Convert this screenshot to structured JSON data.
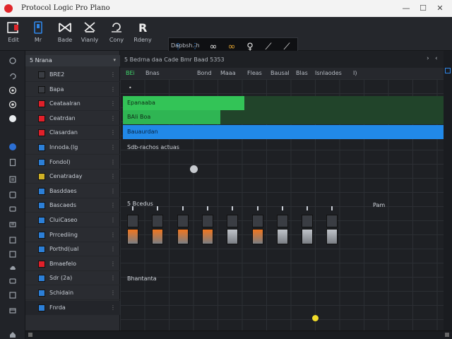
{
  "window": {
    "title": "Protocol Logic Pro Plano"
  },
  "toolbar": {
    "tools": [
      {
        "icon": "record-square-icon",
        "label": "Edit"
      },
      {
        "icon": "phone-icon",
        "label": "Mr"
      },
      {
        "icon": "bowtie-icon",
        "label": "Bade"
      },
      {
        "icon": "scissors-icon",
        "label": "Vianly"
      },
      {
        "icon": "undo-icon",
        "label": "Cony"
      },
      {
        "icon": "r-letter-icon",
        "label": "Rdeny"
      }
    ],
    "brushes_label": "Dapbsh..h",
    "brushes": [
      {
        "icon": "tuning-fork-icon",
        "glyph": "⫯",
        "color": "#2f86e8"
      },
      {
        "icon": "mixer-icon",
        "glyph": "⫶",
        "color": "#2f86e8"
      },
      {
        "icon": "infinity-icon",
        "glyph": "∞",
        "color": "#e6e6e6"
      },
      {
        "icon": "infinity-gold-icon",
        "glyph": "∞",
        "color": "#e5a531"
      },
      {
        "icon": "lens-icon",
        "glyph": "♀",
        "color": "#e6e6e6"
      },
      {
        "icon": "curve-icon",
        "glyph": "⟋",
        "color": "#e6e6e6"
      },
      {
        "icon": "arc-icon",
        "glyph": "⟋",
        "color": "#e6e6e6"
      }
    ]
  },
  "tracklist": {
    "header": "5 Nrana",
    "tracks": [
      {
        "name": "BRE2",
        "color": "#3a3d43"
      },
      {
        "name": "Bapa",
        "color": "#3a3d43"
      },
      {
        "name": "Ceataalran",
        "color": "#e0202a"
      },
      {
        "name": "Ceatrdan",
        "color": "#e0202a"
      },
      {
        "name": "Clasardan",
        "color": "#e0202a"
      },
      {
        "name": "Innoda.(lg",
        "color": "#2c7fd7"
      },
      {
        "name": "Fondol)",
        "color": "#2c7fd7"
      },
      {
        "name": "Cenatraday",
        "color": "#d0b126"
      },
      {
        "name": "Basddaes",
        "color": "#2c7fd7"
      },
      {
        "name": "Bascaeds",
        "color": "#2c7fd7"
      },
      {
        "name": "CluiCaseo",
        "color": "#2c7fd7"
      },
      {
        "name": "Prrcediing",
        "color": "#2c7fd7"
      },
      {
        "name": "Porthd(ual",
        "color": "#2c7fd7"
      },
      {
        "name": "Bmaefelo",
        "color": "#e0202a"
      },
      {
        "name": "Sdr (2a)",
        "color": "#2c7fd7"
      },
      {
        "name": "Schidain",
        "color": "#2c7fd7"
      },
      {
        "name": "Fnrda",
        "color": "#2c7fd7"
      }
    ]
  },
  "main": {
    "bar_info": "5 Bedrna daa  Cade Bmr Baad 5353",
    "ruler": [
      {
        "text": "BEi",
        "color": "#3fd46a"
      },
      {
        "text": "Bnas"
      },
      {
        "text": "Bond"
      },
      {
        "text": "Maaa"
      },
      {
        "text": "Fleas"
      },
      {
        "text": "Bausal"
      },
      {
        "text": "Blas"
      },
      {
        "text": "Isnlaodes"
      },
      {
        "text": "I)"
      }
    ],
    "clips": [
      {
        "label": "Epanaaba",
        "color": "#33c457"
      },
      {
        "label": "BAli Boa",
        "color": "#2fb553"
      },
      {
        "label": "Bauaurdan",
        "color": "#2189e8"
      }
    ],
    "sections": {
      "sub": "Sdb-rachos actuas",
      "left": "5 Bcedus",
      "right": "Pam",
      "bottom": "Bhantanta"
    },
    "faders": [
      {
        "color": "#f0761f"
      },
      {
        "color": "#f0761f"
      },
      {
        "color": "#f0761f"
      },
      {
        "color": "#f0761f"
      },
      {
        "color": "#bfc3c9"
      },
      {
        "color": "#f0761f"
      },
      {
        "color": "#bfc3c9"
      },
      {
        "color": "#bfc3c9"
      },
      {
        "color": "#bfc3c9"
      }
    ]
  },
  "colors": {
    "accent_yellow": "#f1dc2a",
    "record_red": "#e0262b"
  }
}
